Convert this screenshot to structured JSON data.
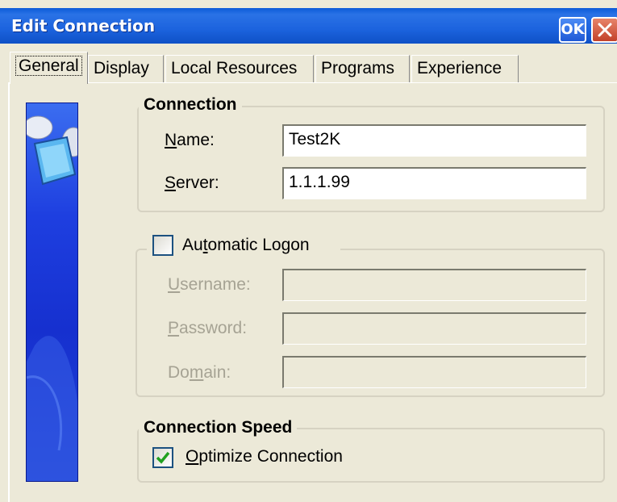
{
  "window": {
    "title": "Edit Connection",
    "ok_label": "OK"
  },
  "tabs": [
    {
      "label": "General",
      "active": true
    },
    {
      "label": "Display",
      "active": false
    },
    {
      "label": "Local Resources",
      "active": false
    },
    {
      "label": "Programs",
      "active": false
    },
    {
      "label": "Experience",
      "active": false
    }
  ],
  "connection": {
    "title": "Connection",
    "name_label_ul": "N",
    "name_label_rest": "ame:",
    "name_value": "Test2K",
    "server_label_ul": "S",
    "server_label_rest": "erver:",
    "server_value": "1.1.1.99"
  },
  "logon": {
    "checkbox_label_pre": "Au",
    "checkbox_label_ul": "t",
    "checkbox_label_post": "omatic Logon",
    "checked": false,
    "username_label_ul": "U",
    "username_label_rest": "sername:",
    "username_value": "",
    "password_label_ul": "P",
    "password_label_rest": "assword:",
    "password_value": "",
    "domain_label_pre": "Do",
    "domain_label_ul": "m",
    "domain_label_post": "ain:",
    "domain_value": ""
  },
  "speed": {
    "title": "Connection Speed",
    "optimize_label_ul": "O",
    "optimize_label_rest": "ptimize Connection",
    "optimize_checked": true
  },
  "colors": {
    "titlebar": "#0B5BD8",
    "window_bg": "#ECE9D8",
    "disabled_text": "#A6A394",
    "check_green": "#21A121"
  }
}
